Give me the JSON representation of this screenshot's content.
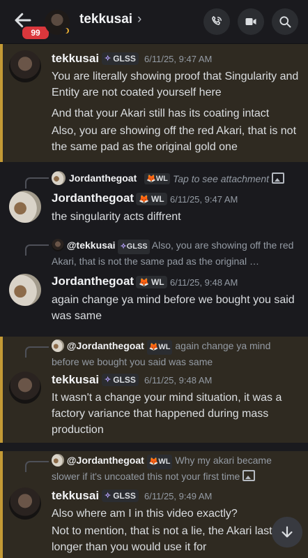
{
  "header": {
    "back_label": "back",
    "unread_count": "99",
    "title": "tekkusai",
    "chevron": "›",
    "icons": [
      "call-icon",
      "video-icon",
      "search-icon"
    ]
  },
  "messages": [
    {
      "author": "tekkusai",
      "tag": "GLSS",
      "time": "6/11/25, 9:47 AM",
      "highlighted": true,
      "lines": [
        "You are literally showing proof that Singularity and Entity are not coated yourself here",
        "And that your Akari still has its coating intact",
        "Also, you are showing off the red Akari, that is not the same pad as the original gold one"
      ]
    },
    {
      "reply": {
        "name": "Jordanthegoat",
        "tag": "WL",
        "text": "Tap to see attachment"
      },
      "author": "Jordanthegoat",
      "tag": "WL",
      "time": "6/11/25, 9:47 AM",
      "lines": [
        "the singularity acts diffrent"
      ]
    },
    {
      "reply": {
        "name": "@tekkusai",
        "tag": "GLSS",
        "text": "Also, you are showing off the red Akari, that is not the same pad as the original …"
      },
      "author": "Jordanthegoat",
      "tag": "WL",
      "time": "6/11/25, 9:48 AM",
      "lines": [
        "again change ya mind before we bought you said was same"
      ]
    },
    {
      "reply": {
        "name": "@Jordanthegoat",
        "tag": "WL",
        "text": "again change ya mind before we bought you said was same"
      },
      "author": "tekkusai",
      "tag": "GLSS",
      "time": "6/11/25, 9:48 AM",
      "highlighted": true,
      "lines": [
        "It wasn't a change your mind situation, it was a factory variance that happened during mass production"
      ]
    },
    {
      "reply": {
        "name": "@Jordanthegoat",
        "tag": "WL",
        "text": "Why my akari became slower if it's uncoated this not your first time"
      },
      "author": "tekkusai",
      "tag": "GLSS",
      "time": "6/11/25, 9:49 AM",
      "highlighted": true,
      "lines": [
        "Also where am I in this video exactly?",
        "Not to mention, that is not a lie, the Akari last longer than you would use it for"
      ]
    }
  ],
  "colors": {
    "highlight_bg": "#2f2a21",
    "highlight_bar": "#c49a35",
    "badge": "#da373c"
  }
}
